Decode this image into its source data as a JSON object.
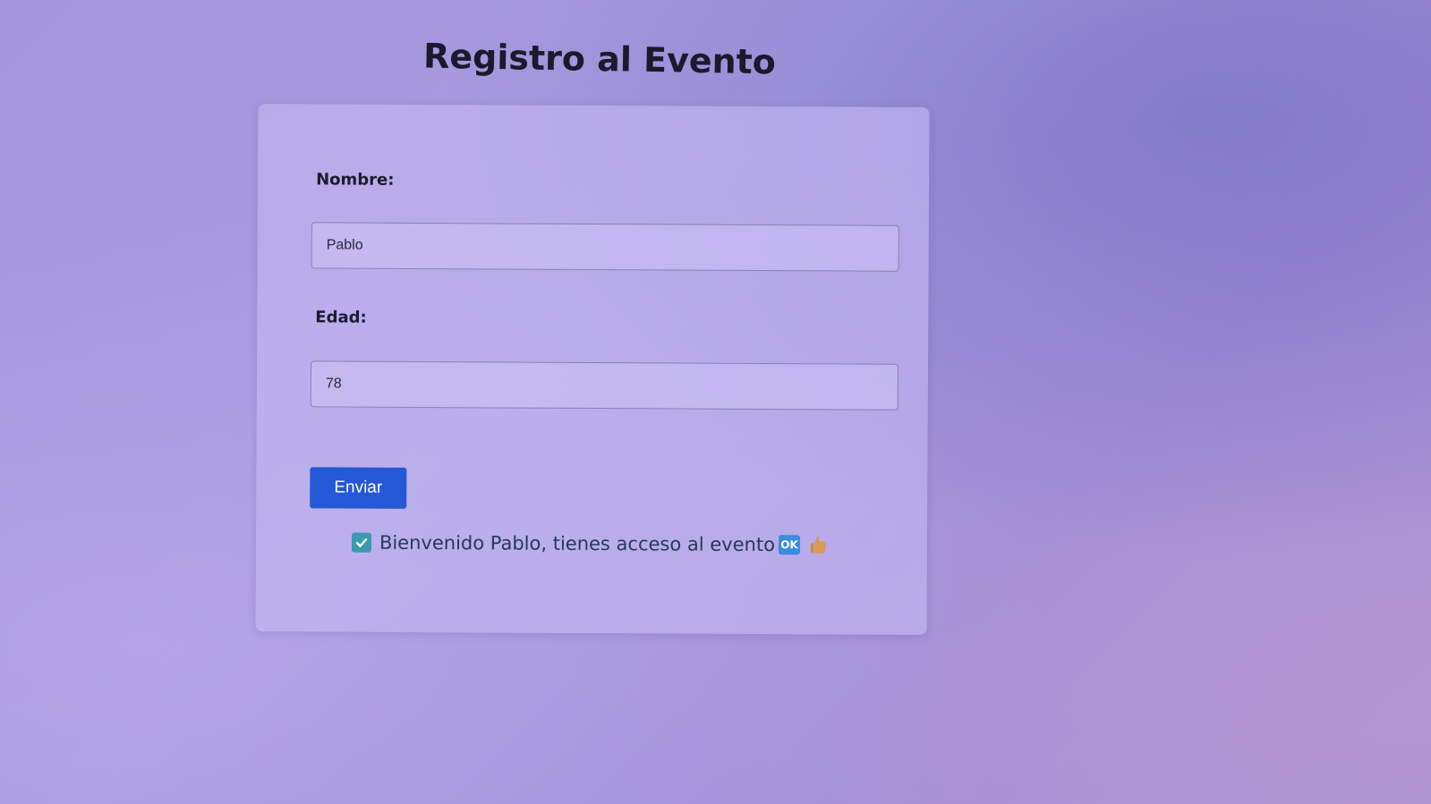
{
  "page": {
    "title": "Registro al Evento"
  },
  "form": {
    "name_label": "Nombre:",
    "name_value": "Pablo",
    "age_label": "Edad:",
    "age_value": "78",
    "submit_label": "Enviar"
  },
  "result": {
    "message": "Bienvenido Pablo, tienes acceso al evento",
    "icons": [
      "check-icon",
      "ok-icon",
      "thumbs-up-icon"
    ],
    "ok_icon_text": "OK"
  },
  "colors": {
    "submit_button": "#2458d6",
    "check_icon": "#3a9ab0",
    "ok_icon": "#3b8de0",
    "message_text": "#253a57"
  }
}
